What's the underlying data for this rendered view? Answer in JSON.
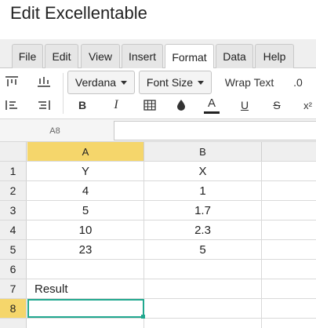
{
  "window": {
    "title": "Edit Excellentable"
  },
  "tabs": [
    {
      "label": "File"
    },
    {
      "label": "Edit"
    },
    {
      "label": "View"
    },
    {
      "label": "Insert"
    },
    {
      "label": "Format",
      "active": true
    },
    {
      "label": "Data"
    },
    {
      "label": "Help"
    }
  ],
  "toolbar": {
    "font_family": "Verdana",
    "font_size_label": "Font Size",
    "wrap_text_label": "Wrap Text",
    "decimal_label": ".0",
    "bold_label": "B",
    "italic_label": "I",
    "underline_label": "U",
    "strikethrough_label": "S",
    "superscript_label": "x²",
    "font_color_label": "A",
    "icons": [
      "align-top-icon",
      "align-bottom-icon",
      "align-top-left-icon",
      "align-bottom-right-icon",
      "borders-icon",
      "fill-color-icon",
      "font-color-icon"
    ]
  },
  "formula_bar": {
    "cell_ref": "A8",
    "value": ""
  },
  "grid": {
    "columns": [
      "A",
      "B"
    ],
    "selected_column": "A",
    "selected_row": "8",
    "rows": [
      {
        "num": "1",
        "a": "Y",
        "b": "X"
      },
      {
        "num": "2",
        "a": "4",
        "b": "1"
      },
      {
        "num": "3",
        "a": "5",
        "b": "1.7"
      },
      {
        "num": "4",
        "a": "10",
        "b": "2.3"
      },
      {
        "num": "5",
        "a": "23",
        "b": "5"
      },
      {
        "num": "6",
        "a": "",
        "b": ""
      },
      {
        "num": "7",
        "a": "Result",
        "b": ""
      },
      {
        "num": "8",
        "a": "",
        "b": ""
      }
    ]
  },
  "colors": {
    "selection": "#21a88f",
    "header_highlight": "#f5d66b"
  }
}
